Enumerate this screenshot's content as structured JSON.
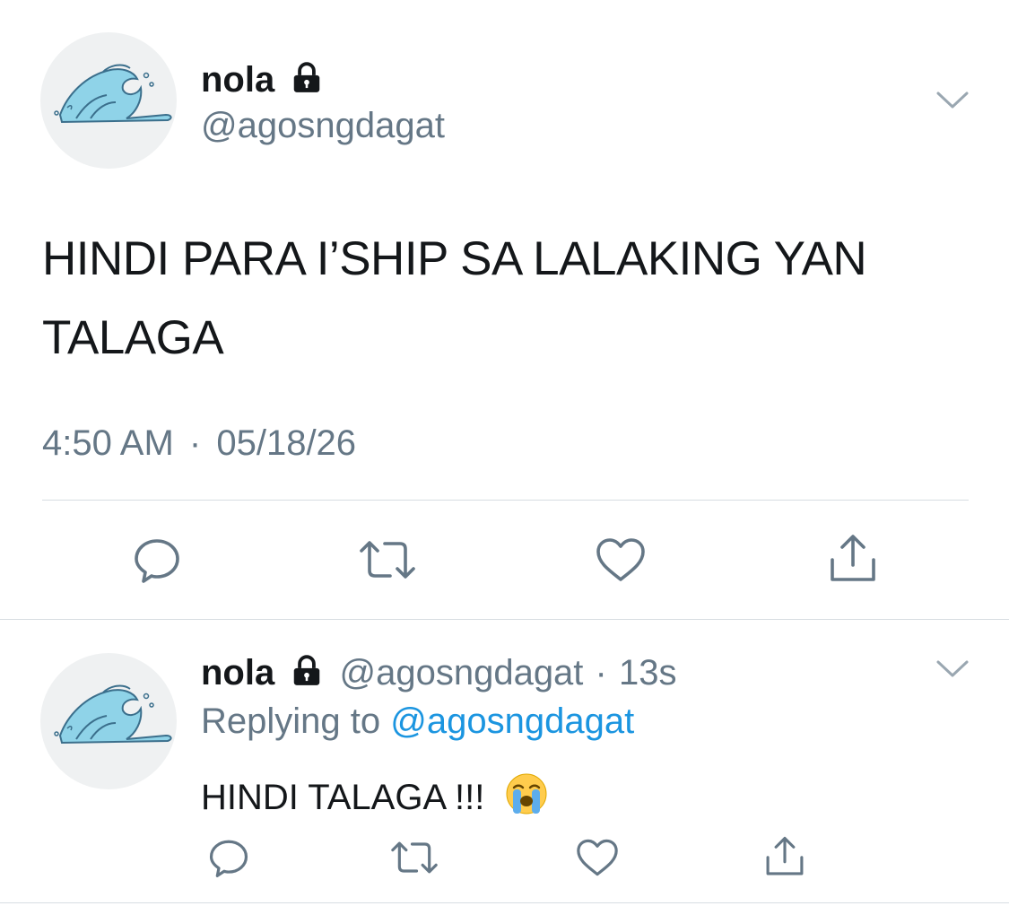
{
  "main_tweet": {
    "display_name": "nola",
    "handle": "@agosngdagat",
    "text": "HINDI PARA I’SHIP SA LALAKING YAN TALAGA",
    "time": "4:50 AM",
    "separator": "·",
    "date": "05/18/26"
  },
  "reply_tweet": {
    "display_name": "nola",
    "handle": "@agosngdagat",
    "separator": "·",
    "age": "13s",
    "replying_prefix": "Replying to",
    "replying_to": "@agosngdagat",
    "text": "HINDI TALAGA !!!",
    "emoji": "😭"
  },
  "icons": {
    "avatar": "wave-avatar",
    "lock": "lock-icon",
    "menu": "chevron-down-icon",
    "actions": [
      "reply-icon",
      "retweet-icon",
      "like-icon",
      "share-icon"
    ]
  },
  "colors": {
    "text": "#14171a",
    "secondary": "#657786",
    "link": "#1b95e0",
    "divider": "#d7dde2",
    "icon": "#657786"
  }
}
